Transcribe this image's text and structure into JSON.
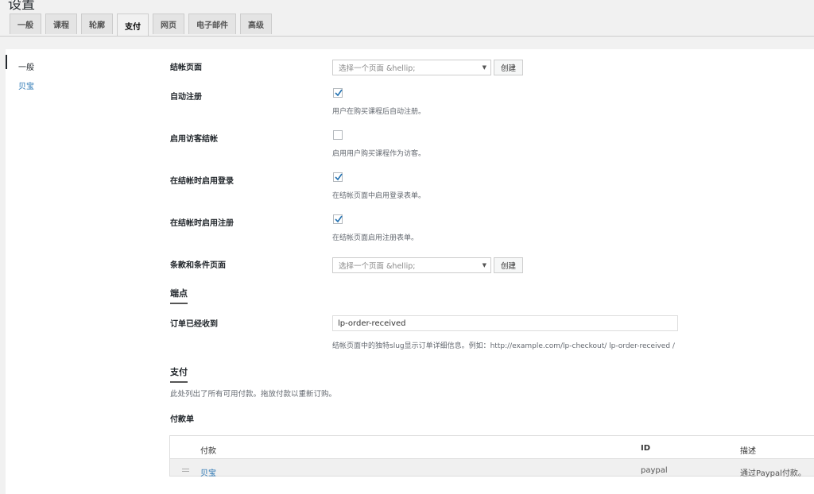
{
  "page": {
    "title": "设置"
  },
  "tabs": [
    {
      "label": "一般"
    },
    {
      "label": "课程"
    },
    {
      "label": "轮廓"
    },
    {
      "label": "支付",
      "active": true
    },
    {
      "label": "网页"
    },
    {
      "label": "电子邮件"
    },
    {
      "label": "高级"
    }
  ],
  "sidebar": {
    "items": [
      {
        "label": "一般"
      },
      {
        "label": "贝宝"
      }
    ]
  },
  "settings": {
    "checkout_page": {
      "label": "结帐页面",
      "placeholder": "选择一个页面 &hellip;",
      "create": "创建"
    },
    "auto_register": {
      "label": "自动注册",
      "desc": "用户在购买课程后自动注册。",
      "checked": true
    },
    "guest_checkout": {
      "label": "启用访客结帐",
      "desc": "启用用户购买课程作为访客。",
      "checked": false
    },
    "login_checkout": {
      "label": "在结帐时启用登录",
      "desc": "在结帐页面中启用登录表单。",
      "checked": true
    },
    "register_checkout": {
      "label": "在结帐时启用注册",
      "desc": "在结帐页面启用注册表单。",
      "checked": true
    },
    "terms_page": {
      "label": "条款和条件页面",
      "placeholder": "选择一个页面 &hellip;",
      "create": "创建"
    }
  },
  "endpoints": {
    "heading": "端点",
    "order_received": {
      "label": "订单已经收到",
      "value": "lp-order-received",
      "desc": "结帐页面中的独特slug显示订单详细信息。例如：http://example.com/lp-checkout/ lp-order-received /"
    }
  },
  "payments": {
    "heading": "支付",
    "desc": "此处列出了所有可用付款。拖放付款以重新订购。",
    "list_label": "付款单",
    "columns": {
      "payment": "付款",
      "id": "ID",
      "desc": "描述"
    },
    "rows": [
      {
        "name": "贝宝",
        "id": "paypal",
        "desc": "通过Paypal付款。"
      }
    ]
  }
}
